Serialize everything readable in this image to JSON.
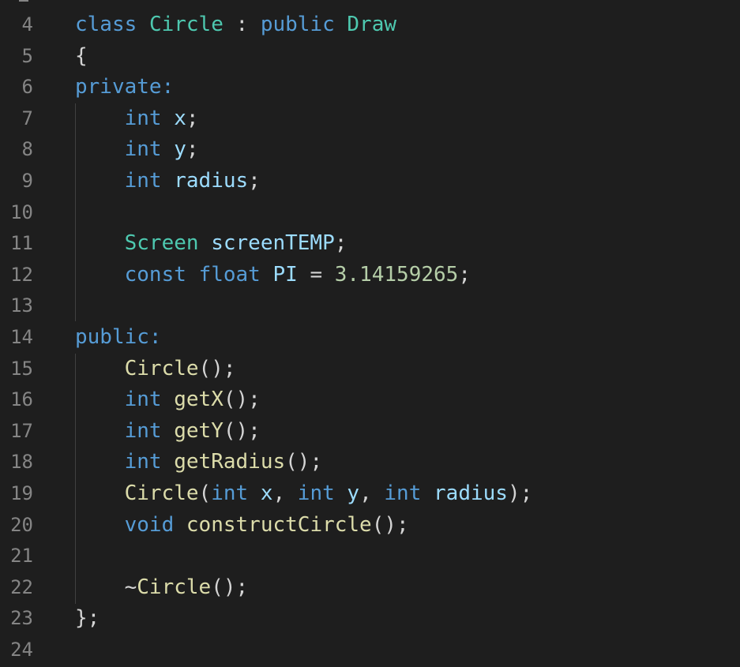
{
  "editor": {
    "colors": {
      "background": "#1e1e1e",
      "line_number": "#858585",
      "keyword": "#569cd6",
      "type": "#4ec9b0",
      "function": "#dcdcaa",
      "variable": "#9cdcfe",
      "number": "#b5cea8",
      "punctuation": "#d4d4d4"
    },
    "lines": [
      {
        "num": "4",
        "tokens": [
          {
            "t": "class",
            "c": "kw"
          },
          {
            "t": " ",
            "c": "pn"
          },
          {
            "t": "Circle",
            "c": "ty"
          },
          {
            "t": " : ",
            "c": "pn"
          },
          {
            "t": "public",
            "c": "kw"
          },
          {
            "t": " ",
            "c": "pn"
          },
          {
            "t": "Draw",
            "c": "ty"
          }
        ]
      },
      {
        "num": "5",
        "tokens": [
          {
            "t": "{",
            "c": "pn"
          }
        ]
      },
      {
        "num": "6",
        "tokens": [
          {
            "t": "private:",
            "c": "kw"
          }
        ]
      },
      {
        "num": "7",
        "tokens": [
          {
            "t": "    ",
            "c": "pn"
          },
          {
            "t": "int",
            "c": "kw"
          },
          {
            "t": " ",
            "c": "pn"
          },
          {
            "t": "x",
            "c": "vr"
          },
          {
            "t": ";",
            "c": "pn"
          }
        ]
      },
      {
        "num": "8",
        "tokens": [
          {
            "t": "    ",
            "c": "pn"
          },
          {
            "t": "int",
            "c": "kw"
          },
          {
            "t": " ",
            "c": "pn"
          },
          {
            "t": "y",
            "c": "vr"
          },
          {
            "t": ";",
            "c": "pn"
          }
        ]
      },
      {
        "num": "9",
        "tokens": [
          {
            "t": "    ",
            "c": "pn"
          },
          {
            "t": "int",
            "c": "kw"
          },
          {
            "t": " ",
            "c": "pn"
          },
          {
            "t": "radius",
            "c": "vr"
          },
          {
            "t": ";",
            "c": "pn"
          }
        ]
      },
      {
        "num": "10",
        "tokens": []
      },
      {
        "num": "11",
        "tokens": [
          {
            "t": "    ",
            "c": "pn"
          },
          {
            "t": "Screen",
            "c": "ty"
          },
          {
            "t": " ",
            "c": "pn"
          },
          {
            "t": "screenTEMP",
            "c": "vr"
          },
          {
            "t": ";",
            "c": "pn"
          }
        ]
      },
      {
        "num": "12",
        "tokens": [
          {
            "t": "    ",
            "c": "pn"
          },
          {
            "t": "const",
            "c": "kw"
          },
          {
            "t": " ",
            "c": "pn"
          },
          {
            "t": "float",
            "c": "kw"
          },
          {
            "t": " ",
            "c": "pn"
          },
          {
            "t": "PI",
            "c": "vr"
          },
          {
            "t": " = ",
            "c": "pn"
          },
          {
            "t": "3.14159265",
            "c": "num"
          },
          {
            "t": ";",
            "c": "pn"
          }
        ]
      },
      {
        "num": "13",
        "tokens": []
      },
      {
        "num": "14",
        "tokens": [
          {
            "t": "public:",
            "c": "kw"
          }
        ]
      },
      {
        "num": "15",
        "tokens": [
          {
            "t": "    ",
            "c": "pn"
          },
          {
            "t": "Circle",
            "c": "fn"
          },
          {
            "t": "();",
            "c": "pn"
          }
        ]
      },
      {
        "num": "16",
        "tokens": [
          {
            "t": "    ",
            "c": "pn"
          },
          {
            "t": "int",
            "c": "kw"
          },
          {
            "t": " ",
            "c": "pn"
          },
          {
            "t": "getX",
            "c": "fn"
          },
          {
            "t": "();",
            "c": "pn"
          }
        ]
      },
      {
        "num": "17",
        "tokens": [
          {
            "t": "    ",
            "c": "pn"
          },
          {
            "t": "int",
            "c": "kw"
          },
          {
            "t": " ",
            "c": "pn"
          },
          {
            "t": "getY",
            "c": "fn"
          },
          {
            "t": "();",
            "c": "pn"
          }
        ]
      },
      {
        "num": "18",
        "tokens": [
          {
            "t": "    ",
            "c": "pn"
          },
          {
            "t": "int",
            "c": "kw"
          },
          {
            "t": " ",
            "c": "pn"
          },
          {
            "t": "getRadius",
            "c": "fn"
          },
          {
            "t": "();",
            "c": "pn"
          }
        ]
      },
      {
        "num": "19",
        "tokens": [
          {
            "t": "    ",
            "c": "pn"
          },
          {
            "t": "Circle",
            "c": "fn"
          },
          {
            "t": "(",
            "c": "pn"
          },
          {
            "t": "int",
            "c": "kw"
          },
          {
            "t": " ",
            "c": "pn"
          },
          {
            "t": "x",
            "c": "vr"
          },
          {
            "t": ", ",
            "c": "pn"
          },
          {
            "t": "int",
            "c": "kw"
          },
          {
            "t": " ",
            "c": "pn"
          },
          {
            "t": "y",
            "c": "vr"
          },
          {
            "t": ", ",
            "c": "pn"
          },
          {
            "t": "int",
            "c": "kw"
          },
          {
            "t": " ",
            "c": "pn"
          },
          {
            "t": "radius",
            "c": "vr"
          },
          {
            "t": ");",
            "c": "pn"
          }
        ]
      },
      {
        "num": "20",
        "tokens": [
          {
            "t": "    ",
            "c": "pn"
          },
          {
            "t": "void",
            "c": "kw"
          },
          {
            "t": " ",
            "c": "pn"
          },
          {
            "t": "constructCircle",
            "c": "fn"
          },
          {
            "t": "();",
            "c": "pn"
          }
        ]
      },
      {
        "num": "21",
        "tokens": []
      },
      {
        "num": "22",
        "tokens": [
          {
            "t": "    ",
            "c": "pn"
          },
          {
            "t": "~",
            "c": "pn"
          },
          {
            "t": "Circle",
            "c": "fn"
          },
          {
            "t": "();",
            "c": "pn"
          }
        ]
      },
      {
        "num": "23",
        "tokens": [
          {
            "t": "};",
            "c": "pn"
          }
        ]
      },
      {
        "num": "24",
        "tokens": []
      }
    ]
  }
}
